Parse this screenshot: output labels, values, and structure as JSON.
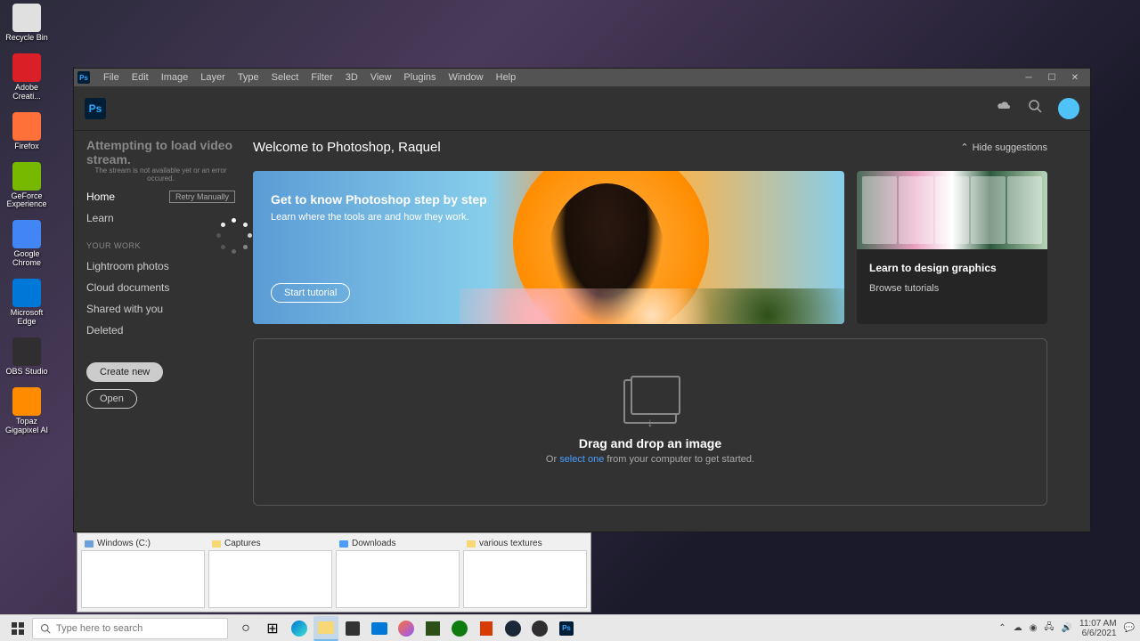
{
  "desktop": {
    "icons": [
      {
        "name": "recycle-bin",
        "label": "Recycle Bin",
        "color": "#e0e0e0"
      },
      {
        "name": "adobe-cc",
        "label": "Adobe Creati...",
        "color": "#da1f26"
      },
      {
        "name": "firefox",
        "label": "Firefox",
        "color": "#ff7139"
      },
      {
        "name": "geforce",
        "label": "GeForce Experience",
        "color": "#76b900"
      },
      {
        "name": "chrome",
        "label": "Google Chrome",
        "color": "#4285f4"
      },
      {
        "name": "edge",
        "label": "Microsoft Edge",
        "color": "#0078d7"
      },
      {
        "name": "obs",
        "label": "OBS Studio",
        "color": "#302e31"
      },
      {
        "name": "topaz",
        "label": "Topaz Gigapixel AI",
        "color": "#ff8c00"
      }
    ]
  },
  "ps": {
    "menu": [
      "File",
      "Edit",
      "Image",
      "Layer",
      "Type",
      "Select",
      "Filter",
      "3D",
      "View",
      "Plugins",
      "Window",
      "Help"
    ],
    "video_error_title": "Attempting to load video stream.",
    "video_error_sub": "The stream is not available yet or an error occured.",
    "retry": "Retry Manually",
    "nav": [
      {
        "label": "Home",
        "active": true
      },
      {
        "label": "Learn",
        "active": false
      }
    ],
    "section": "YOUR WORK",
    "work": [
      "Lightroom photos",
      "Cloud documents",
      "Shared with you",
      "Deleted"
    ],
    "create": "Create new",
    "open": "Open",
    "welcome": "Welcome to Photoshop, Raquel",
    "hide": "Hide suggestions",
    "hero": {
      "title": "Get to know Photoshop step by step",
      "sub": "Learn where the tools are and how they work.",
      "btn": "Start tutorial"
    },
    "sidecard": {
      "title": "Learn to design graphics",
      "link": "Browse tutorials"
    },
    "drop": {
      "title": "Drag and drop an image",
      "or": "Or ",
      "select": "select one",
      "rest": " from your computer to get started."
    }
  },
  "explorer": [
    {
      "label": "Windows (C:)",
      "icon": "drive"
    },
    {
      "label": "Captures",
      "icon": "folder"
    },
    {
      "label": "Downloads",
      "icon": "download"
    },
    {
      "label": "various textures",
      "icon": "folder"
    }
  ],
  "taskbar": {
    "search_placeholder": "Type here to search",
    "time": "11:07 AM",
    "date": "6/6/2021"
  }
}
